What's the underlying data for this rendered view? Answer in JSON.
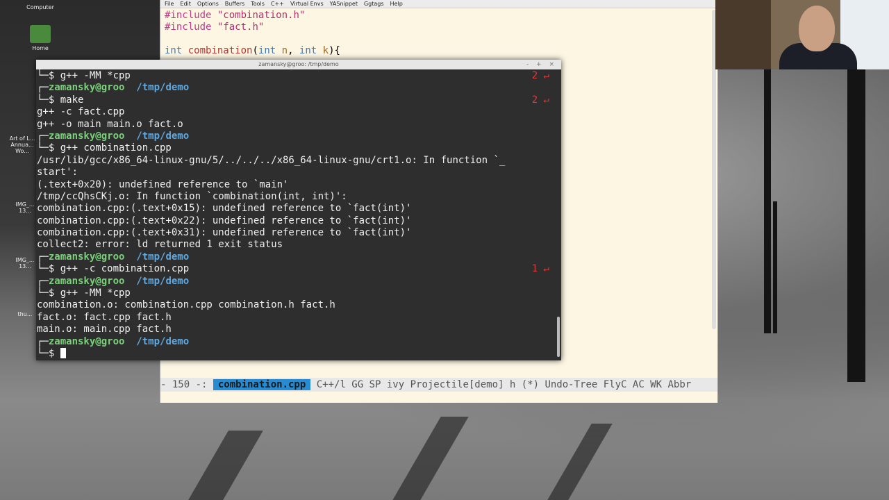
{
  "desktop": {
    "icons": [
      {
        "label": "Computer"
      },
      {
        "label": "Home"
      },
      {
        "label": "Art of L..."
      },
      {
        "label": "Annua..."
      },
      {
        "label": "Wo..."
      },
      {
        "label": "IMG_..."
      },
      {
        "label": "13..."
      },
      {
        "label": "IMG_..."
      },
      {
        "label": "13..."
      },
      {
        "label": "thu..."
      }
    ]
  },
  "emacs": {
    "menu": [
      "File",
      "Edit",
      "Options",
      "Buffers",
      "Tools",
      "C++",
      "Virtual Envs",
      "YASnippet",
      "Ggtags",
      "Help"
    ],
    "lines": {
      "l1_kw": "#include",
      "l1_str": "\"combination.h\"",
      "l2_kw": "#include",
      "l2_str": "\"fact.h\"",
      "l4_type": "int",
      "l4_fn": "combination",
      "l4_p1type": "int",
      "l4_p1": "n",
      "l4_p2type": "int",
      "l4_p2": "k",
      "l4_end": "){"
    },
    "modeline": {
      "prefix": " - 150 -: ",
      "buffer": "combination.cpp",
      "modes": "C++/l GG SP ivy Projectile[demo] h (*) Undo-Tree FlyC AC WK Abbr"
    }
  },
  "terminal": {
    "title": "zamansky@groo: /tmp/demo",
    "controls": "- + ×",
    "prompt_user": "zamansky@groo",
    "prompt_path": "/tmp/demo",
    "lines": [
      {
        "kind": "cmd",
        "text": "$ g++ -MM *cpp",
        "rc": "2 ↵"
      },
      {
        "kind": "prompt"
      },
      {
        "kind": "cmd",
        "text": "$ make",
        "rc": "2 ↵"
      },
      {
        "kind": "out",
        "text": "g++ -c fact.cpp"
      },
      {
        "kind": "out",
        "text": "g++ -o main main.o fact.o"
      },
      {
        "kind": "prompt"
      },
      {
        "kind": "cmd",
        "text": "$ g++ combination.cpp"
      },
      {
        "kind": "out",
        "text": "/usr/lib/gcc/x86_64-linux-gnu/5/../../../x86_64-linux-gnu/crt1.o: In function `_"
      },
      {
        "kind": "out",
        "text": "start':"
      },
      {
        "kind": "out",
        "text": "(.text+0x20): undefined reference to `main'"
      },
      {
        "kind": "out",
        "text": "/tmp/ccQhsCKj.o: In function `combination(int, int)':"
      },
      {
        "kind": "out",
        "text": "combination.cpp:(.text+0x15): undefined reference to `fact(int)'"
      },
      {
        "kind": "out",
        "text": "combination.cpp:(.text+0x22): undefined reference to `fact(int)'"
      },
      {
        "kind": "out",
        "text": "combination.cpp:(.text+0x31): undefined reference to `fact(int)'"
      },
      {
        "kind": "out",
        "text": "collect2: error: ld returned 1 exit status"
      },
      {
        "kind": "prompt"
      },
      {
        "kind": "cmd",
        "text": "$ g++ -c combination.cpp",
        "rc": "1 ↵"
      },
      {
        "kind": "prompt"
      },
      {
        "kind": "cmd",
        "text": "$ g++ -MM *cpp"
      },
      {
        "kind": "out",
        "text": "combination.o: combination.cpp combination.h fact.h"
      },
      {
        "kind": "out",
        "text": "fact.o: fact.cpp fact.h"
      },
      {
        "kind": "out",
        "text": "main.o: main.cpp fact.h"
      },
      {
        "kind": "prompt"
      },
      {
        "kind": "input",
        "text": "$ "
      }
    ]
  }
}
